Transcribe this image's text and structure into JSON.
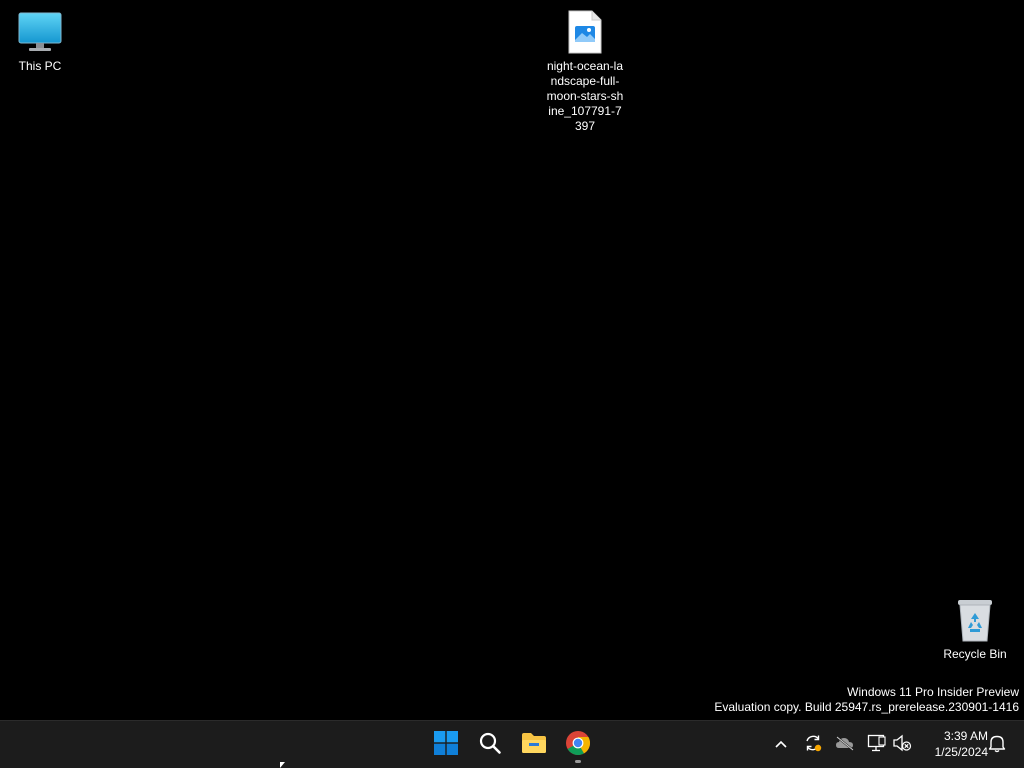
{
  "desktop": {
    "icons": [
      {
        "id": "this-pc",
        "label": "This PC",
        "icon": "monitor-icon"
      },
      {
        "id": "image-file",
        "label": "night-ocean-landscape-full-moon-stars-shine_107791-7397",
        "icon": "image-file-icon"
      },
      {
        "id": "recycle-bin",
        "label": "Recycle Bin",
        "icon": "recycle-bin-icon"
      }
    ]
  },
  "watermark": {
    "line1": "Windows 11 Pro Insider Preview",
    "line2": "Evaluation copy. Build 25947.rs_prerelease.230901-1416"
  },
  "taskbar": {
    "pinned": [
      {
        "name": "Start",
        "icon": "windows-logo-icon"
      },
      {
        "name": "Search",
        "icon": "search-icon"
      },
      {
        "name": "File Explorer",
        "icon": "folder-icon"
      },
      {
        "name": "Google Chrome",
        "icon": "chrome-icon",
        "running": true
      }
    ],
    "tray": {
      "icons": [
        "chevron-up-icon",
        "update-icon",
        "onedrive-icon",
        "network-icon",
        "volume-muted-icon",
        "bell-icon"
      ],
      "time": "3:39 AM",
      "date": "1/25/2024"
    }
  },
  "colors": {
    "desktop_bg": "#000000",
    "taskbar_bg": "#1c1c1c",
    "windows_blue": "#0078d4",
    "folder_yellow": "#f6c343"
  }
}
